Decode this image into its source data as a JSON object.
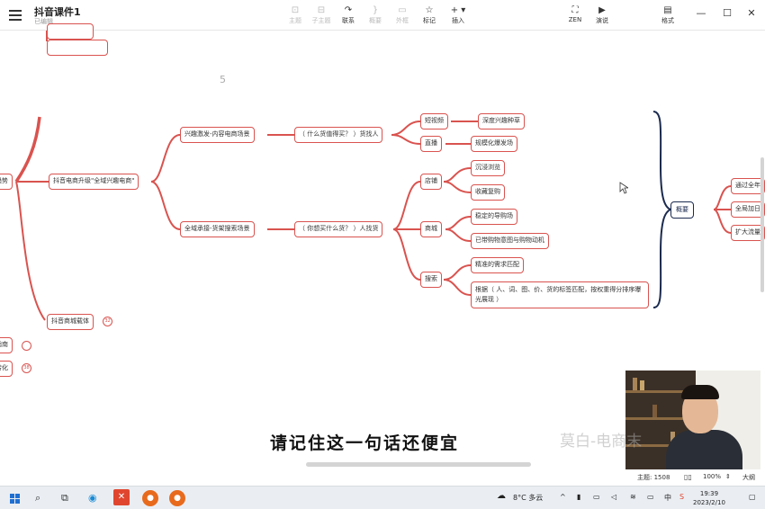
{
  "app": {
    "title": "抖音课件1",
    "subtitle": "已编辑"
  },
  "toolbar": {
    "items": [
      {
        "label": "主题",
        "icon": "topic-icon",
        "glyph": "⊡",
        "enabled": false
      },
      {
        "label": "子主题",
        "icon": "subtopic-icon",
        "glyph": "⊟",
        "enabled": false
      },
      {
        "label": "联系",
        "icon": "relation-icon",
        "glyph": "↷",
        "enabled": true
      },
      {
        "label": "概要",
        "icon": "summary-icon",
        "glyph": "}",
        "enabled": false
      },
      {
        "label": "外框",
        "icon": "boundary-icon",
        "glyph": "▭",
        "enabled": false
      },
      {
        "label": "标记",
        "icon": "star-icon",
        "glyph": "☆",
        "enabled": true
      },
      {
        "label": "插入",
        "icon": "insert-icon",
        "glyph": "+ ▾",
        "enabled": true
      }
    ],
    "right_items": [
      {
        "label": "ZEN",
        "icon": "zen-icon",
        "glyph": "⛶"
      },
      {
        "label": "演说",
        "icon": "present-icon",
        "glyph": "▶"
      },
      {
        "label": "格式",
        "icon": "format-icon",
        "glyph": "▤"
      }
    ]
  },
  "mindmap": {
    "root_partial": "趋势",
    "stray_char": "5",
    "branch_main": "抖音电商升级\"全域兴趣电商\"",
    "branch_main_2": "抖音商城载体",
    "badge_32": "32",
    "left_nodes": [
      {
        "label": "指南",
        "badge": ""
      },
      {
        "label": "转化",
        "badge": "38"
      }
    ],
    "level2": [
      {
        "label": "兴趣激发-内容电商场景"
      },
      {
        "label": "全域承接-货架搜索场景"
      }
    ],
    "level3": [
      {
        "label": "（ 什么货值得买？ ）货找人"
      },
      {
        "label": "（ 你想买什么货？ ）人找货"
      }
    ],
    "level4": [
      {
        "label": "短视频"
      },
      {
        "label": "直播"
      },
      {
        "label": "店铺"
      },
      {
        "label": "商城"
      },
      {
        "label": "搜索"
      }
    ],
    "level5": [
      {
        "label": "深度兴趣种草"
      },
      {
        "label": "规模化爆发场"
      },
      {
        "label": "沉浸浏览"
      },
      {
        "label": "收藏复购"
      },
      {
        "label": "稳定的导购场"
      },
      {
        "label": "已带购物意图与购物动机"
      },
      {
        "label": "精准的需求匹配"
      },
      {
        "label": "根据（ 人、词、图、价、货的标签匹配，按权重得分排序曝光展现 ）"
      }
    ],
    "summary": "概要",
    "summary_children": [
      "通过全年",
      "全局加日",
      "扩大流量"
    ]
  },
  "overlay": {
    "subtitle": "请记住这一句话还便宜",
    "watermark": "莫白-电商末"
  },
  "statusbar": {
    "topic_count": "主题: 1508",
    "zoom": "100%",
    "outline": "大纲"
  },
  "taskbar": {
    "weather": "8°C 多云",
    "ime": "中",
    "time": "19:39",
    "date": "2023/2/10"
  },
  "colors": {
    "branch": "#d9534f",
    "summary": "#1b2a4e",
    "accent": "#d9534f"
  }
}
